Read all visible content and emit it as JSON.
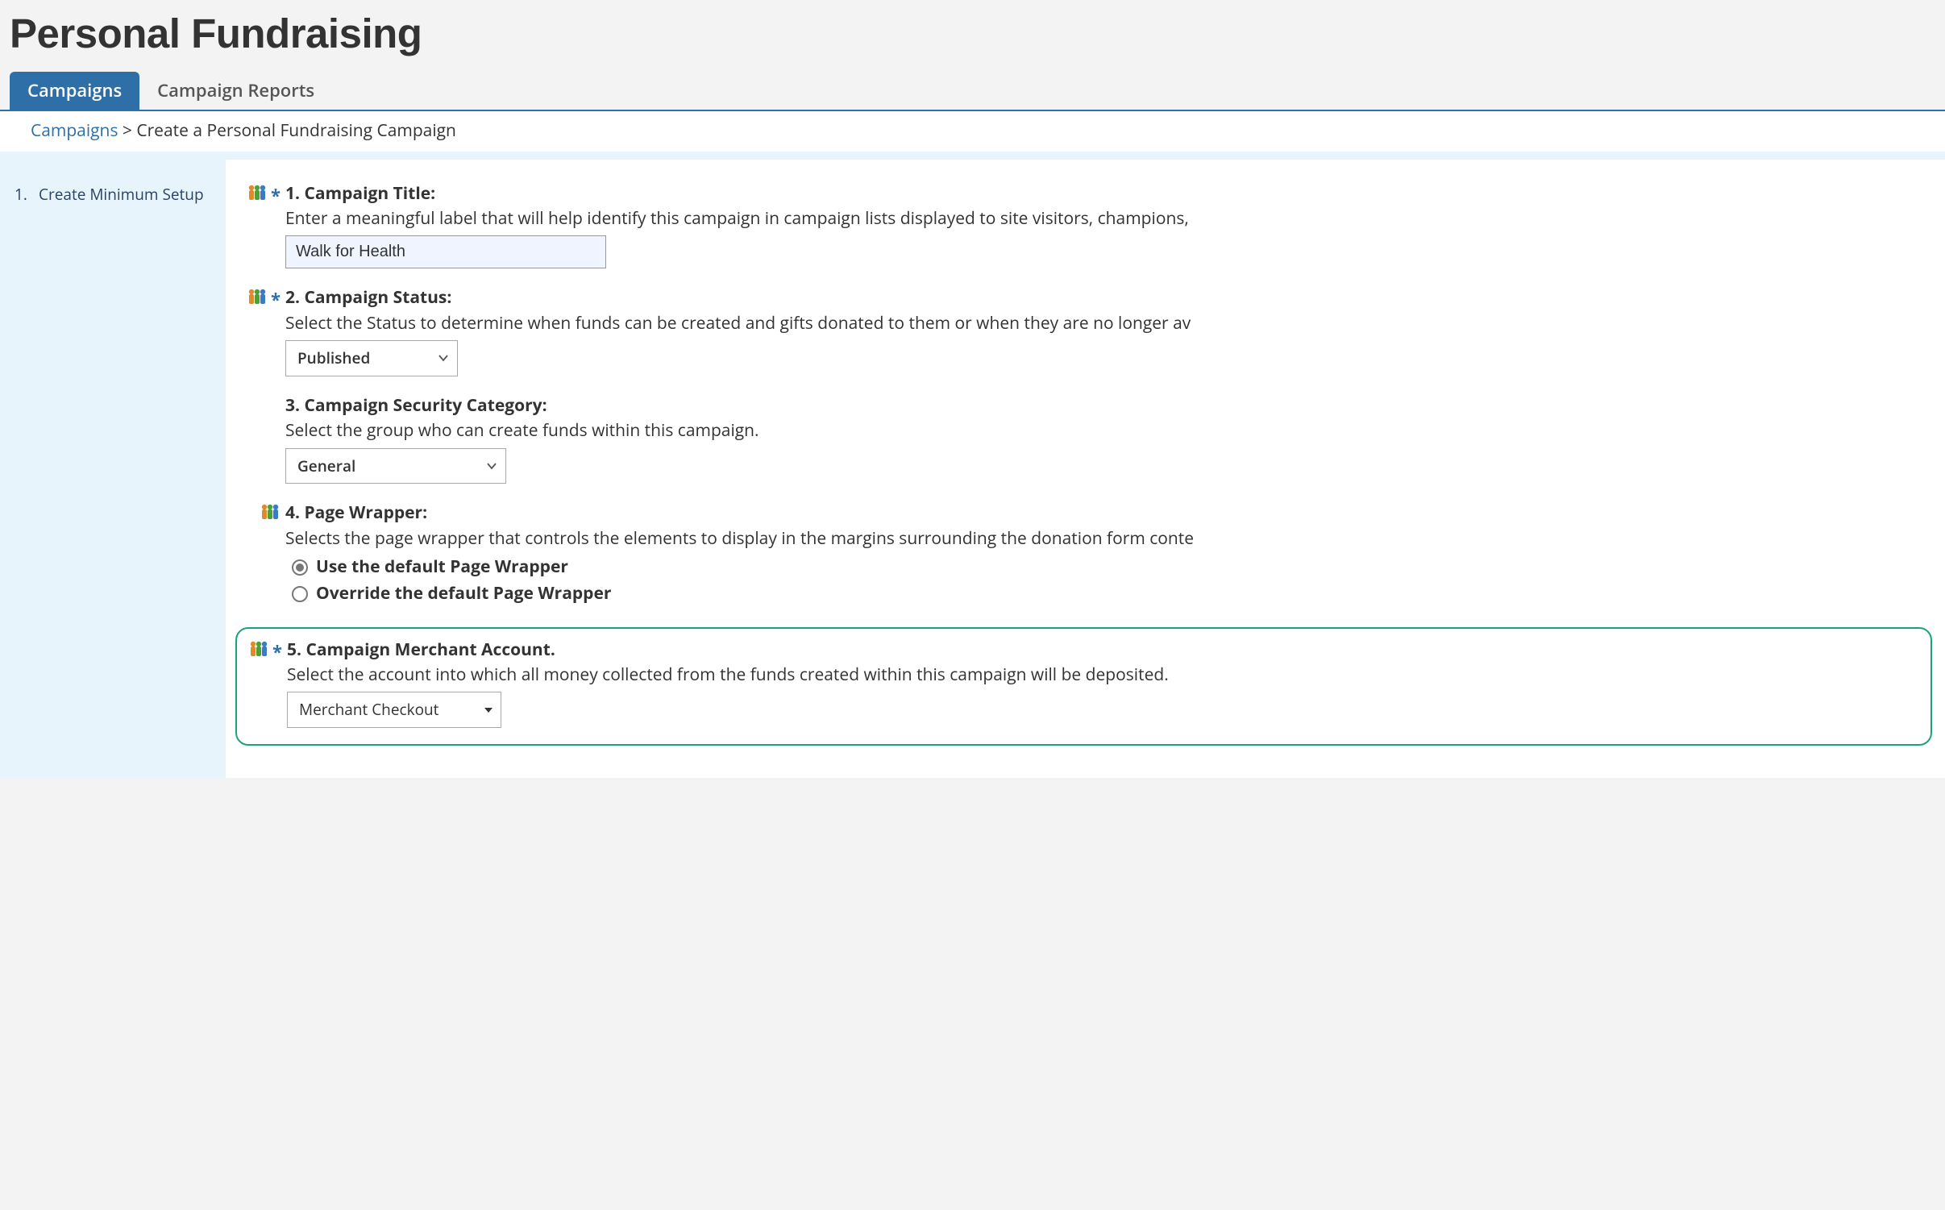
{
  "page_title": "Personal Fundraising",
  "tabs": [
    {
      "label": "Campaigns",
      "active": true
    },
    {
      "label": "Campaign Reports",
      "active": false
    }
  ],
  "breadcrumb": {
    "link_text": "Campaigns",
    "sep": " > ",
    "current": "Create a Personal Fundraising Campaign"
  },
  "sidebar": {
    "step_num": "1.",
    "step_label": "Create Minimum Setup"
  },
  "fields": {
    "title": {
      "label": "1. Campaign Title:",
      "desc": "Enter a meaningful label that will help identify this campaign in campaign lists displayed to site visitors, champions,",
      "value": "Walk for Health"
    },
    "status": {
      "label": "2. Campaign Status:",
      "desc": "Select the Status to determine when funds can be created and gifts donated to them or when they are no longer av",
      "value": "Published"
    },
    "security": {
      "label": "3. Campaign Security Category:",
      "desc": "Select the group who can create funds within this campaign.",
      "value": "General"
    },
    "wrapper": {
      "label": "4. Page Wrapper:",
      "desc": "Selects the page wrapper that controls the elements to display in the margins surrounding the donation form conte",
      "option1": "Use the default Page Wrapper",
      "option2": "Override the default Page Wrapper"
    },
    "merchant": {
      "label": "5. Campaign Merchant Account.",
      "desc": "Select the account into which all money collected from the funds created within this campaign will be deposited.",
      "value": "Merchant Checkout"
    }
  }
}
